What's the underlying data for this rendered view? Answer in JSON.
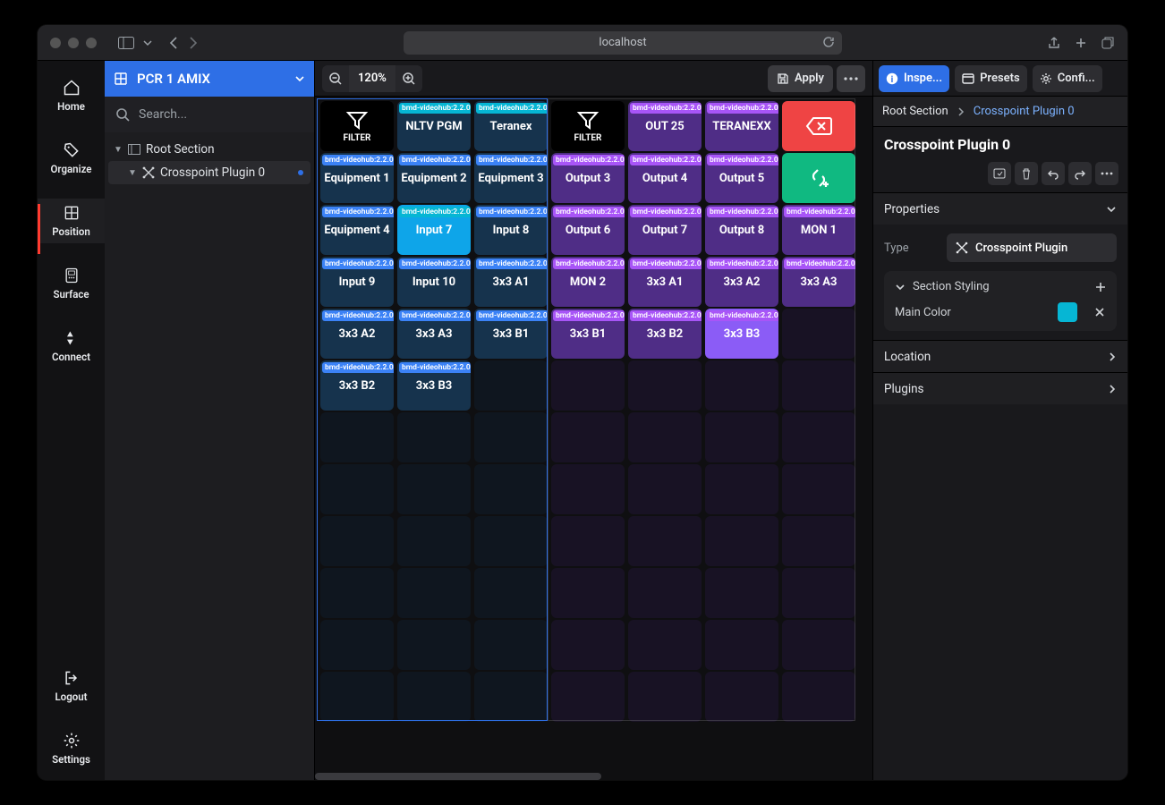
{
  "browser": {
    "address": "localhost"
  },
  "rail": {
    "home": "Home",
    "organize": "Organize",
    "position": "Position",
    "surface": "Surface",
    "connect": "Connect",
    "logout": "Logout",
    "settings": "Settings"
  },
  "tree": {
    "header": "PCR 1 AMIX",
    "search_placeholder": "Search...",
    "root": "Root Section",
    "child": "Crosspoint Plugin 0"
  },
  "canvas_toolbar": {
    "zoom": "120%",
    "apply": "Apply"
  },
  "grid_tag": "bmd-videohub:2.2.0",
  "grid": {
    "filter": "FILTER",
    "left": [
      [
        "",
        "NLTV PGM",
        "Teranex"
      ],
      [
        "Equipment 1",
        "Equipment 2",
        "Equipment 3"
      ],
      [
        "Equipment 4",
        "Input 7",
        "Input 8"
      ],
      [
        "Input 9",
        "Input 10",
        "3x3 A1"
      ],
      [
        "3x3 A2",
        "3x3 A3",
        "3x3 B1"
      ],
      [
        "3x3 B2",
        "3x3 B3",
        ""
      ]
    ],
    "right": [
      [
        "",
        "OUT 25",
        "TERANEXX"
      ],
      [
        "Output 3",
        "Output 4",
        "Output 5"
      ],
      [
        "Output 6",
        "Output 7",
        "Output 8"
      ],
      [
        "MON 2",
        "3x3 A1",
        "3x3 A2"
      ],
      [
        "3x3 B1",
        "3x3 B2",
        "3x3 B3"
      ]
    ],
    "far": [
      "",
      "",
      "MON 1",
      "3x3 A3",
      ""
    ]
  },
  "inspector": {
    "tabs": {
      "inspect": "Inspe...",
      "presets": "Presets",
      "configure": "Confi..."
    },
    "crumb_root": "Root Section",
    "crumb_current": "Crosspoint Plugin 0",
    "title": "Crosspoint Plugin 0",
    "properties": "Properties",
    "type_label": "Type",
    "type_value": "Crosspoint Plugin",
    "section_styling": "Section Styling",
    "main_color": "Main Color",
    "main_color_value": "#06b6d4",
    "location": "Location",
    "plugins": "Plugins"
  }
}
